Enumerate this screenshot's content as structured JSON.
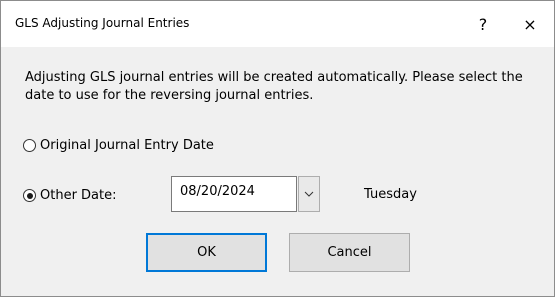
{
  "window": {
    "title": "GLS Adjusting Journal Entries",
    "help_label": "?",
    "close_label": "×"
  },
  "message": "Adjusting GLS journal entries will be created automatically.  Please select the date to use for the reversing journal entries.",
  "options": {
    "original": {
      "label": "Original Journal Entry Date",
      "selected": false
    },
    "other": {
      "label": "Other Date:",
      "selected": true
    }
  },
  "date_field": {
    "value": "08/20/2024",
    "weekday": "Tuesday"
  },
  "buttons": {
    "ok_label": "OK",
    "cancel_label": "Cancel"
  },
  "colors": {
    "focus_accent": "#0078d7",
    "dialog_background": "#f0f0f0",
    "titlebar_background": "#ffffff"
  }
}
